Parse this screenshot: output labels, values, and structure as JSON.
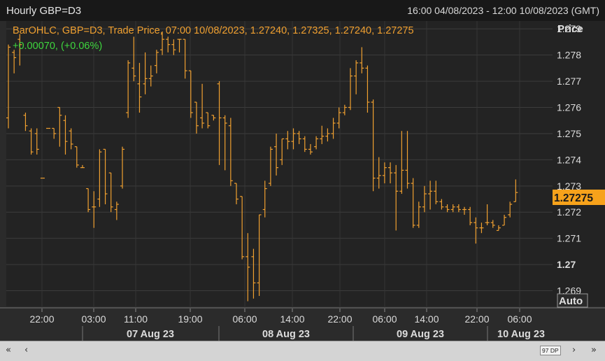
{
  "header": {
    "title": "Hourly GBP=D3",
    "range": "16:00 04/08/2023 - 12:00 10/08/2023 (GMT)"
  },
  "info": {
    "line1": "BarOHLC, GBP=D3, Trade Price, 07:00 10/08/2023, 1.27240, 1.27325, 1.27240, 1.27275",
    "line2": "+0.00070, (+0.06%)"
  },
  "axis": {
    "title": "Price",
    "auto_label": "Auto",
    "current_price": "1.27275"
  },
  "scrollbar": {
    "first": "«",
    "prev": "‹",
    "dp_label": "97 DP",
    "next": "›",
    "last": "»"
  },
  "colors": {
    "background": "#232323",
    "bars": "#f0a030",
    "change_positive": "#3ed63e",
    "price_tag": "#f7a21b"
  },
  "chart_data": {
    "type": "ohlc",
    "title": "Hourly GBP=D3",
    "ylabel": "Price",
    "ylim": [
      1.2684,
      1.2793
    ],
    "yticks": [
      1.269,
      1.27,
      1.271,
      1.272,
      1.273,
      1.274,
      1.275,
      1.276,
      1.277,
      1.278,
      1.279
    ],
    "ytick_labels": [
      "1.269",
      "1.27",
      "1.271",
      "1.272",
      "1.273",
      "1.274",
      "1.275",
      "1.276",
      "1.277",
      "1.278",
      "1.279"
    ],
    "xtick_labels": [
      "22:00",
      "03:00",
      "11:00",
      "19:00",
      "06:00",
      "14:00",
      "22:00",
      "06:00",
      "14:00",
      "22:00",
      "06:00"
    ],
    "date_labels": [
      "07 Aug 23",
      "08 Aug 23",
      "09 Aug 23",
      "10 Aug 23"
    ],
    "grid": true,
    "last_price": 1.27275,
    "bars": [
      {
        "o": 1.2756,
        "h": 1.2784,
        "l": 1.2752,
        "c": 1.2783
      },
      {
        "o": 1.2781,
        "h": 1.2782,
        "l": 1.2773,
        "c": 1.2779
      },
      {
        "o": 1.2786,
        "h": 1.2788,
        "l": 1.2776,
        "c": 1.2784
      },
      {
        "o": 1.2757,
        "h": 1.2758,
        "l": 1.2751,
        "c": 1.2753
      },
      {
        "o": 1.2751,
        "h": 1.2752,
        "l": 1.2742,
        "c": 1.2743
      },
      {
        "o": 1.275,
        "h": 1.2752,
        "l": 1.2742,
        "c": 1.2744
      },
      {
        "o": 1.2733,
        "h": 1.2733,
        "l": 1.2733,
        "c": 1.2733
      },
      {
        "o": 1.2752,
        "h": 1.2752,
        "l": 1.2752,
        "c": 1.2752
      },
      {
        "o": 1.2752,
        "h": 1.2752,
        "l": 1.2748,
        "c": 1.275
      },
      {
        "o": 1.276,
        "h": 1.276,
        "l": 1.2745,
        "c": 1.2757
      },
      {
        "o": 1.2755,
        "h": 1.2757,
        "l": 1.2742,
        "c": 1.2747
      },
      {
        "o": 1.2751,
        "h": 1.2752,
        "l": 1.2744,
        "c": 1.2746
      },
      {
        "o": 1.2745,
        "h": 1.2745,
        "l": 1.2737,
        "c": 1.2738
      },
      {
        "o": 1.2737,
        "h": 1.2738,
        "l": 1.2737,
        "c": 1.2737
      },
      {
        "o": 1.2729,
        "h": 1.2729,
        "l": 1.272,
        "c": 1.2721
      },
      {
        "o": 1.2722,
        "h": 1.2728,
        "l": 1.2714,
        "c": 1.2722
      },
      {
        "o": 1.2725,
        "h": 1.2744,
        "l": 1.2722,
        "c": 1.2743
      },
      {
        "o": 1.2744,
        "h": 1.2744,
        "l": 1.2723,
        "c": 1.2727
      },
      {
        "o": 1.2735,
        "h": 1.2735,
        "l": 1.272,
        "c": 1.2722
      },
      {
        "o": 1.2721,
        "h": 1.2724,
        "l": 1.2717,
        "c": 1.2723
      },
      {
        "o": 1.273,
        "h": 1.2745,
        "l": 1.2729,
        "c": 1.2744
      },
      {
        "o": 1.2758,
        "h": 1.2778,
        "l": 1.2756,
        "c": 1.2777
      },
      {
        "o": 1.2775,
        "h": 1.2787,
        "l": 1.277,
        "c": 1.2772
      },
      {
        "o": 1.2769,
        "h": 1.2777,
        "l": 1.2758,
        "c": 1.2764
      },
      {
        "o": 1.2769,
        "h": 1.2781,
        "l": 1.2765,
        "c": 1.2771
      },
      {
        "o": 1.2771,
        "h": 1.2776,
        "l": 1.2768,
        "c": 1.2772
      },
      {
        "o": 1.2776,
        "h": 1.2782,
        "l": 1.2773,
        "c": 1.2781
      },
      {
        "o": 1.2782,
        "h": 1.2789,
        "l": 1.278,
        "c": 1.2786
      },
      {
        "o": 1.2786,
        "h": 1.2787,
        "l": 1.2781,
        "c": 1.2784
      },
      {
        "o": 1.2784,
        "h": 1.2786,
        "l": 1.278,
        "c": 1.2782
      },
      {
        "o": 1.2786,
        "h": 1.2786,
        "l": 1.2781,
        "c": 1.2786
      },
      {
        "o": 1.2786,
        "h": 1.2786,
        "l": 1.2771,
        "c": 1.2774
      },
      {
        "o": 1.2774,
        "h": 1.2774,
        "l": 1.2756,
        "c": 1.2758
      },
      {
        "o": 1.2762,
        "h": 1.2762,
        "l": 1.275,
        "c": 1.2753
      },
      {
        "o": 1.2756,
        "h": 1.2769,
        "l": 1.2752,
        "c": 1.2754
      },
      {
        "o": 1.2758,
        "h": 1.2758,
        "l": 1.2752,
        "c": 1.2753
      },
      {
        "o": 1.2757,
        "h": 1.2757,
        "l": 1.2755,
        "c": 1.2756
      },
      {
        "o": 1.2769,
        "h": 1.277,
        "l": 1.2738,
        "c": 1.2756
      },
      {
        "o": 1.2756,
        "h": 1.2757,
        "l": 1.2736,
        "c": 1.2754
      },
      {
        "o": 1.2753,
        "h": 1.2756,
        "l": 1.273,
        "c": 1.2732
      },
      {
        "o": 1.2731,
        "h": 1.2731,
        "l": 1.2723,
        "c": 1.2725
      },
      {
        "o": 1.2726,
        "h": 1.2726,
        "l": 1.2702,
        "c": 1.2703
      },
      {
        "o": 1.2703,
        "h": 1.2712,
        "l": 1.2686,
        "c": 1.2699
      },
      {
        "o": 1.2703,
        "h": 1.2706,
        "l": 1.2687,
        "c": 1.2693
      },
      {
        "o": 1.2693,
        "h": 1.2719,
        "l": 1.2688,
        "c": 1.2719
      },
      {
        "o": 1.2721,
        "h": 1.2732,
        "l": 1.2718,
        "c": 1.2729
      },
      {
        "o": 1.2731,
        "h": 1.2745,
        "l": 1.273,
        "c": 1.2744
      },
      {
        "o": 1.2745,
        "h": 1.275,
        "l": 1.2734,
        "c": 1.2737
      },
      {
        "o": 1.274,
        "h": 1.2748,
        "l": 1.2738,
        "c": 1.2748
      },
      {
        "o": 1.2748,
        "h": 1.2751,
        "l": 1.2744,
        "c": 1.2747
      },
      {
        "o": 1.2747,
        "h": 1.2752,
        "l": 1.2744,
        "c": 1.275
      },
      {
        "o": 1.275,
        "h": 1.2751,
        "l": 1.2746,
        "c": 1.2748
      },
      {
        "o": 1.2748,
        "h": 1.2749,
        "l": 1.2743,
        "c": 1.2744
      },
      {
        "o": 1.2744,
        "h": 1.2746,
        "l": 1.2742,
        "c": 1.2743
      },
      {
        "o": 1.2745,
        "h": 1.2749,
        "l": 1.2744,
        "c": 1.2748
      },
      {
        "o": 1.2748,
        "h": 1.2753,
        "l": 1.2746,
        "c": 1.2749
      },
      {
        "o": 1.2749,
        "h": 1.2752,
        "l": 1.2747,
        "c": 1.275
      },
      {
        "o": 1.275,
        "h": 1.2756,
        "l": 1.2748,
        "c": 1.2754
      },
      {
        "o": 1.2754,
        "h": 1.276,
        "l": 1.2752,
        "c": 1.2758
      },
      {
        "o": 1.2758,
        "h": 1.2761,
        "l": 1.2757,
        "c": 1.276
      },
      {
        "o": 1.276,
        "h": 1.2775,
        "l": 1.2759,
        "c": 1.2772
      },
      {
        "o": 1.2772,
        "h": 1.2778,
        "l": 1.2765,
        "c": 1.2777
      },
      {
        "o": 1.2777,
        "h": 1.2783,
        "l": 1.2773,
        "c": 1.2775
      },
      {
        "o": 1.2775,
        "h": 1.2776,
        "l": 1.2758,
        "c": 1.2762
      },
      {
        "o": 1.2762,
        "h": 1.2763,
        "l": 1.2728,
        "c": 1.2733
      },
      {
        "o": 1.2733,
        "h": 1.2741,
        "l": 1.2729,
        "c": 1.2734
      },
      {
        "o": 1.2734,
        "h": 1.2739,
        "l": 1.2731,
        "c": 1.2737
      },
      {
        "o": 1.2737,
        "h": 1.2739,
        "l": 1.2731,
        "c": 1.2735
      },
      {
        "o": 1.2735,
        "h": 1.2738,
        "l": 1.2713,
        "c": 1.2728
      },
      {
        "o": 1.2728,
        "h": 1.2751,
        "l": 1.2727,
        "c": 1.2736
      },
      {
        "o": 1.2736,
        "h": 1.2751,
        "l": 1.2729,
        "c": 1.2731
      },
      {
        "o": 1.2731,
        "h": 1.2733,
        "l": 1.2714,
        "c": 1.2715
      },
      {
        "o": 1.2715,
        "h": 1.2724,
        "l": 1.2714,
        "c": 1.2722
      },
      {
        "o": 1.2722,
        "h": 1.273,
        "l": 1.272,
        "c": 1.2727
      },
      {
        "o": 1.2727,
        "h": 1.2732,
        "l": 1.2721,
        "c": 1.2728
      },
      {
        "o": 1.2728,
        "h": 1.2732,
        "l": 1.2723,
        "c": 1.2724
      },
      {
        "o": 1.2724,
        "h": 1.2725,
        "l": 1.2721,
        "c": 1.2722
      },
      {
        "o": 1.2722,
        "h": 1.2723,
        "l": 1.272,
        "c": 1.2721
      },
      {
        "o": 1.2721,
        "h": 1.2723,
        "l": 1.272,
        "c": 1.2722
      },
      {
        "o": 1.2722,
        "h": 1.2723,
        "l": 1.272,
        "c": 1.2721
      },
      {
        "o": 1.2721,
        "h": 1.2722,
        "l": 1.2719,
        "c": 1.2721
      },
      {
        "o": 1.2721,
        "h": 1.2722,
        "l": 1.2715,
        "c": 1.2716
      },
      {
        "o": 1.2716,
        "h": 1.2718,
        "l": 1.2708,
        "c": 1.2714
      },
      {
        "o": 1.2714,
        "h": 1.2716,
        "l": 1.2712,
        "c": 1.2714
      },
      {
        "o": 1.2716,
        "h": 1.2723,
        "l": 1.2715,
        "c": 1.2716
      },
      {
        "o": 1.2716,
        "h": 1.2717,
        "l": 1.2714,
        "c": 1.2715
      },
      {
        "o": 1.2713,
        "h": 1.2715,
        "l": 1.2713,
        "c": 1.2714
      },
      {
        "o": 1.2715,
        "h": 1.2719,
        "l": 1.2715,
        "c": 1.2718
      },
      {
        "o": 1.2719,
        "h": 1.2724,
        "l": 1.2718,
        "c": 1.2723
      },
      {
        "o": 1.2724,
        "h": 1.27325,
        "l": 1.2724,
        "c": 1.27275
      }
    ]
  }
}
